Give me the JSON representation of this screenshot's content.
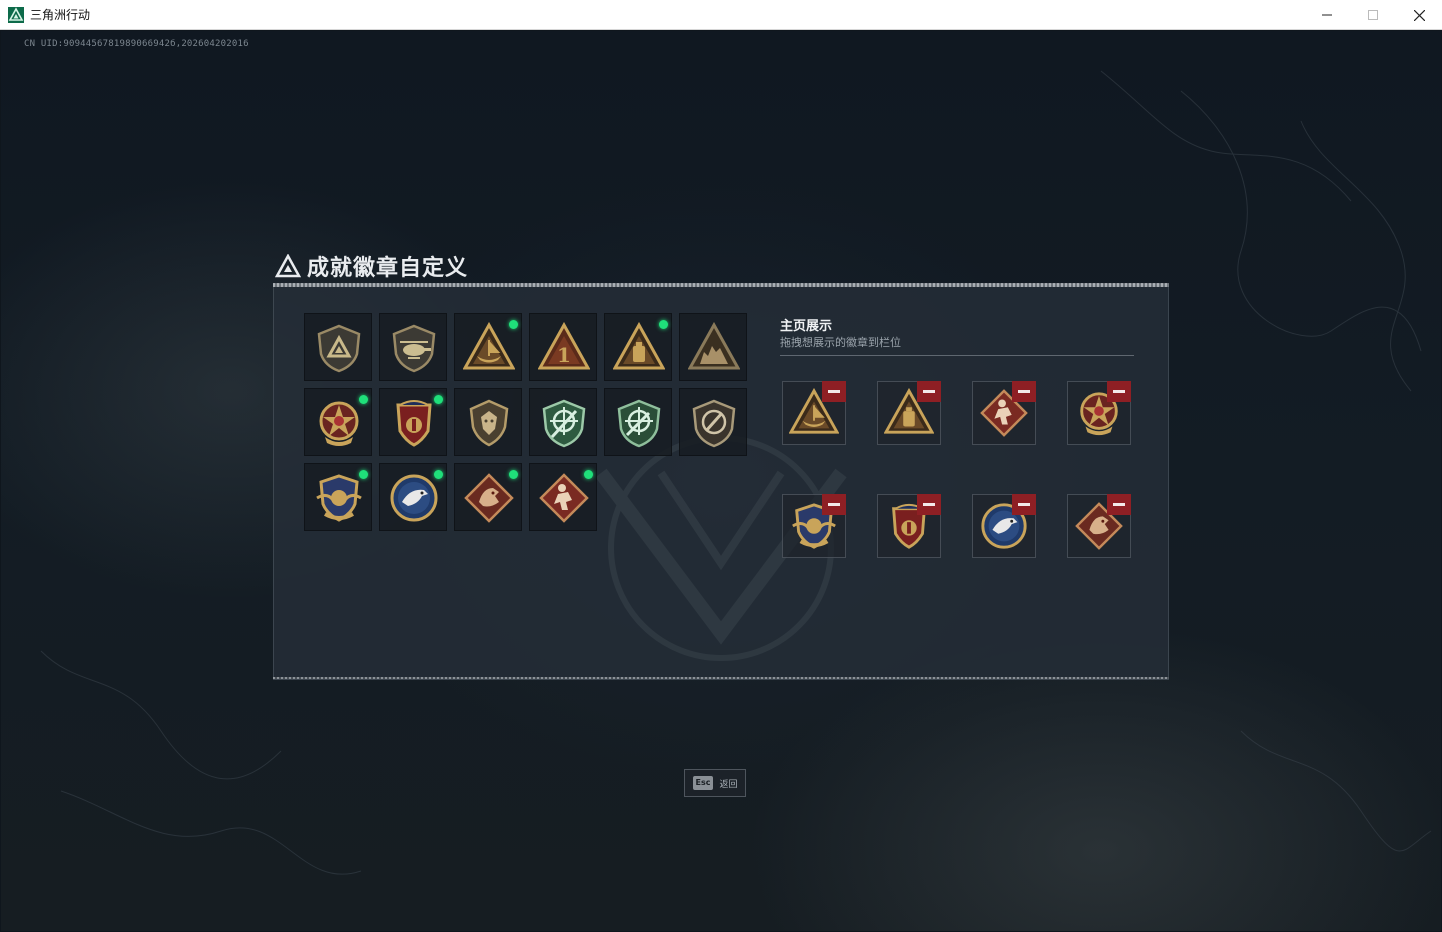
{
  "window": {
    "title": "三角洲行动"
  },
  "header": {
    "uid": "CN UID:9094456781989066942б,202604202016"
  },
  "page": {
    "title": "成就徽章自定义"
  },
  "badges": [
    {
      "icon": "shield-delta-badge-icon",
      "new": false
    },
    {
      "icon": "helicopter-badge-icon",
      "new": false
    },
    {
      "icon": "boat-triangle-badge-icon",
      "new": true
    },
    {
      "icon": "number-one-triangle-badge-icon",
      "new": false
    },
    {
      "icon": "canister-triangle-badge-icon",
      "new": true
    },
    {
      "icon": "ruins-triangle-badge-icon",
      "new": false
    },
    {
      "icon": "star-medal-badge-icon",
      "new": true
    },
    {
      "icon": "crest-medal-badge-icon",
      "new": true
    },
    {
      "icon": "lion-shield-badge-icon",
      "new": false
    },
    {
      "icon": "crosshair-green-shield-badge-icon",
      "new": false
    },
    {
      "icon": "crosshair-green-shield-2-badge-icon",
      "new": false
    },
    {
      "icon": "dark-shield-badge-icon",
      "new": false
    },
    {
      "icon": "winged-shield-badge-icon",
      "new": true
    },
    {
      "icon": "eagle-round-badge-icon",
      "new": true
    },
    {
      "icon": "dragon-diamond-badge-icon",
      "new": true
    },
    {
      "icon": "soldier-diamond-badge-icon",
      "new": true
    }
  ],
  "showcase": {
    "title": "主页展示",
    "subtitle": "拖拽想展示的徽章到栏位",
    "slots": [
      {
        "icon": "boat-triangle-badge-icon"
      },
      {
        "icon": "canister-triangle-badge-icon"
      },
      {
        "icon": "soldier-diamond-badge-icon"
      },
      {
        "icon": "star-medal-badge-icon"
      },
      {
        "icon": "winged-shield-badge-icon"
      },
      {
        "icon": "crest-medal-badge-icon"
      },
      {
        "icon": "eagle-round-badge-icon"
      },
      {
        "icon": "dragon-diamond-badge-icon"
      }
    ]
  },
  "footer": {
    "esc_key": "Esc",
    "back_label": "返回"
  },
  "colors": {
    "new_dot": "#1fe07a",
    "remove": "#8e1f24",
    "gold": "#c9a45a"
  }
}
